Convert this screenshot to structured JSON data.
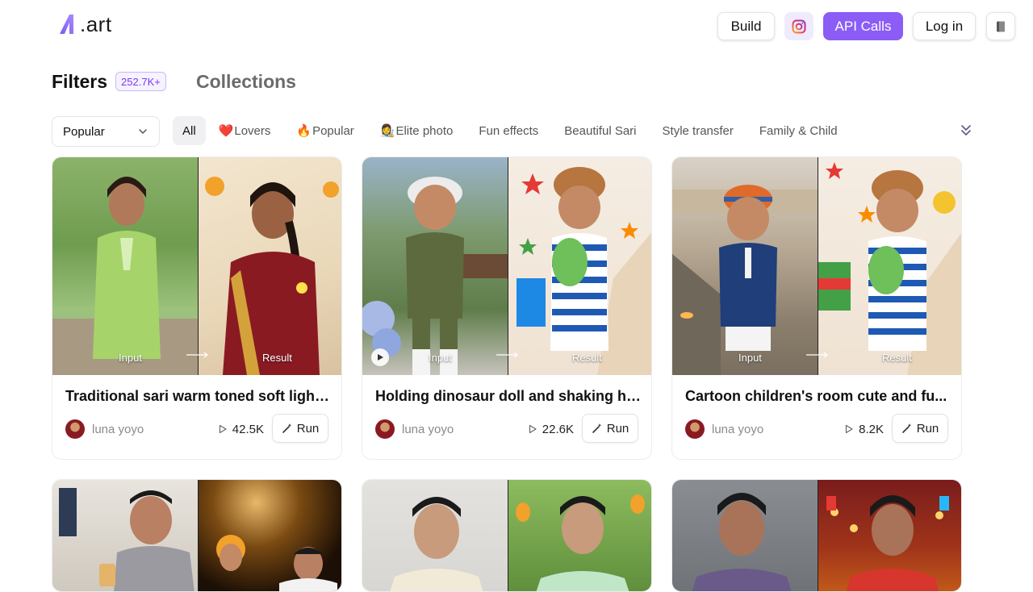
{
  "header": {
    "logo_text": ".art",
    "build_label": "Build",
    "api_label": "API Calls",
    "login_label": "Log in"
  },
  "tabs": {
    "filters_label": "Filters",
    "filters_count": "252.7K+",
    "collections_label": "Collections"
  },
  "sort": {
    "selected": "Popular"
  },
  "categories": [
    {
      "emoji": "",
      "label": "All"
    },
    {
      "emoji": "❤️",
      "label": "Lovers"
    },
    {
      "emoji": "🔥",
      "label": "Popular"
    },
    {
      "emoji": "👩‍🎨",
      "label": "Elite photo"
    },
    {
      "emoji": "",
      "label": "Fun effects"
    },
    {
      "emoji": "",
      "label": "Beautiful Sari"
    },
    {
      "emoji": "",
      "label": "Style transfer"
    },
    {
      "emoji": "",
      "label": "Family & Child"
    }
  ],
  "image_labels": {
    "input": "Input",
    "result": "Result"
  },
  "cards": [
    {
      "title": "Traditional sari warm toned soft light...",
      "author": "luna yoyo",
      "runs": "42.5K",
      "run_label": "Run"
    },
    {
      "title": "Holding dinosaur doll and shaking ha...",
      "author": "luna yoyo",
      "runs": "22.6K",
      "run_label": "Run"
    },
    {
      "title": "Cartoon children's room cute and fu...",
      "author": "luna yoyo",
      "runs": "8.2K",
      "run_label": "Run"
    }
  ],
  "colors": {
    "accent": "#8b5cf6",
    "badge_text": "#7c3aed"
  },
  "icons": {
    "instagram": "instagram-icon",
    "sort_chevron": "chevron-down-icon",
    "expand": "double-chevron-down-icon",
    "runs": "play-outline-icon",
    "run_button": "magic-wand-icon"
  }
}
